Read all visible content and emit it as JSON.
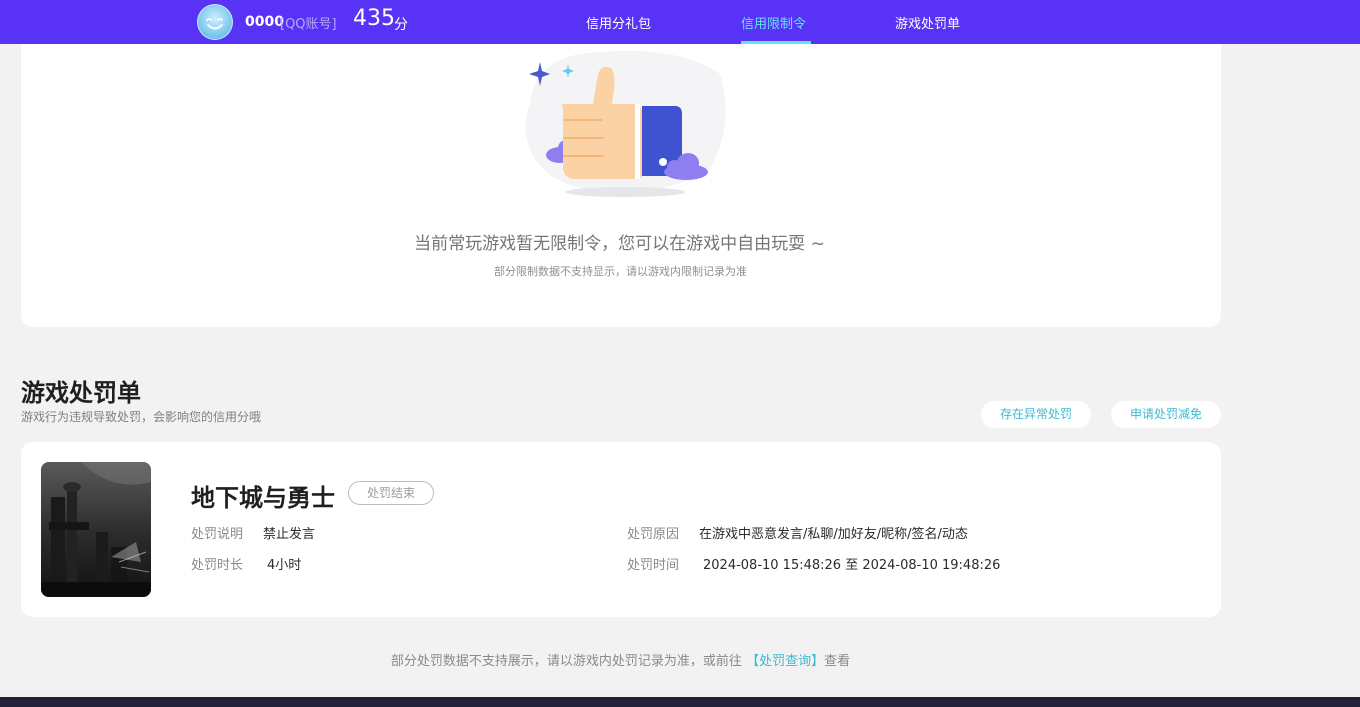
{
  "header": {
    "account_name": "0000",
    "account_tag": "[QQ账号]",
    "score": "435",
    "score_unit": "分",
    "tabs": [
      {
        "label": "信用分礼包",
        "active": false
      },
      {
        "label": "信用限制令",
        "active": true
      },
      {
        "label": "游戏处罚单",
        "active": false
      }
    ],
    "colors": {
      "bar": "#5833f5",
      "active_tab": "#63e3f3"
    }
  },
  "limit_card": {
    "empty_message": "当前常玩游戏暂无限制令，您可以在游戏中自由玩耍 ~",
    "empty_note": "部分限制数据不支持显示，请以游戏内限制记录为准",
    "illustration_icon": "thumbs-up-icon"
  },
  "penalty_section": {
    "title": "游戏处罚单",
    "subtitle": "游戏行为违规导致处罚，会影响您的信用分哦",
    "buttons": {
      "abnormal": "存在异常处罚",
      "reduce": "申请处罚减免"
    }
  },
  "penalty_item": {
    "game_name": "地下城与勇士",
    "status": "处罚结束",
    "fields": {
      "desc_label": "处罚说明",
      "desc_value": "禁止发言",
      "duration_label": "处罚时长",
      "duration_value": "4小时",
      "reason_label": "处罚原因",
      "reason_value": "在游戏中恶意发言/私聊/加好友/昵称/签名/动态",
      "time_label": "处罚时间",
      "time_value": "2024-08-10 15:48:26 至 2024-08-10 19:48:26"
    }
  },
  "footer": {
    "note_prefix": "部分处罚数据不支持展示，请以游戏内处罚记录为准，或前往",
    "link": "【处罚查询】",
    "note_suffix": "查看"
  }
}
